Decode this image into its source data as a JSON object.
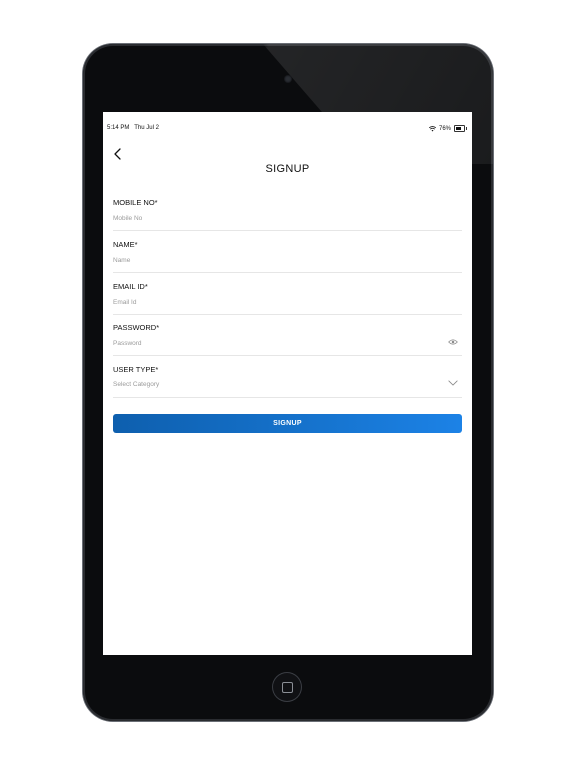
{
  "status_bar": {
    "time": "5:14 PM",
    "date": "Thu Jul 2",
    "battery": "76%",
    "battery_level": 0.76
  },
  "header": {
    "title": "SIGNUP"
  },
  "form": {
    "fields": [
      {
        "label": "MOBILE NO*",
        "placeholder": "Mobile No"
      },
      {
        "label": "NAME*",
        "placeholder": "Name"
      },
      {
        "label": "EMAIL ID*",
        "placeholder": "Email Id"
      },
      {
        "label": "PASSWORD*",
        "placeholder": "Password"
      },
      {
        "label": "USER TYPE*",
        "placeholder": "Select Category"
      }
    ],
    "submit_label": "SIGNUP"
  },
  "icons": {
    "back": "chevron-left-icon",
    "password_toggle": "eye-icon",
    "dropdown": "chevron-down-icon",
    "wifi": "wifi-icon",
    "battery": "battery-icon"
  },
  "colors": {
    "primary_button": "#1674cf",
    "label_text": "#111111",
    "placeholder_text": "#9b9b9b",
    "divider": "#e6e6e6",
    "device_bezel": "#0b0c0e"
  }
}
